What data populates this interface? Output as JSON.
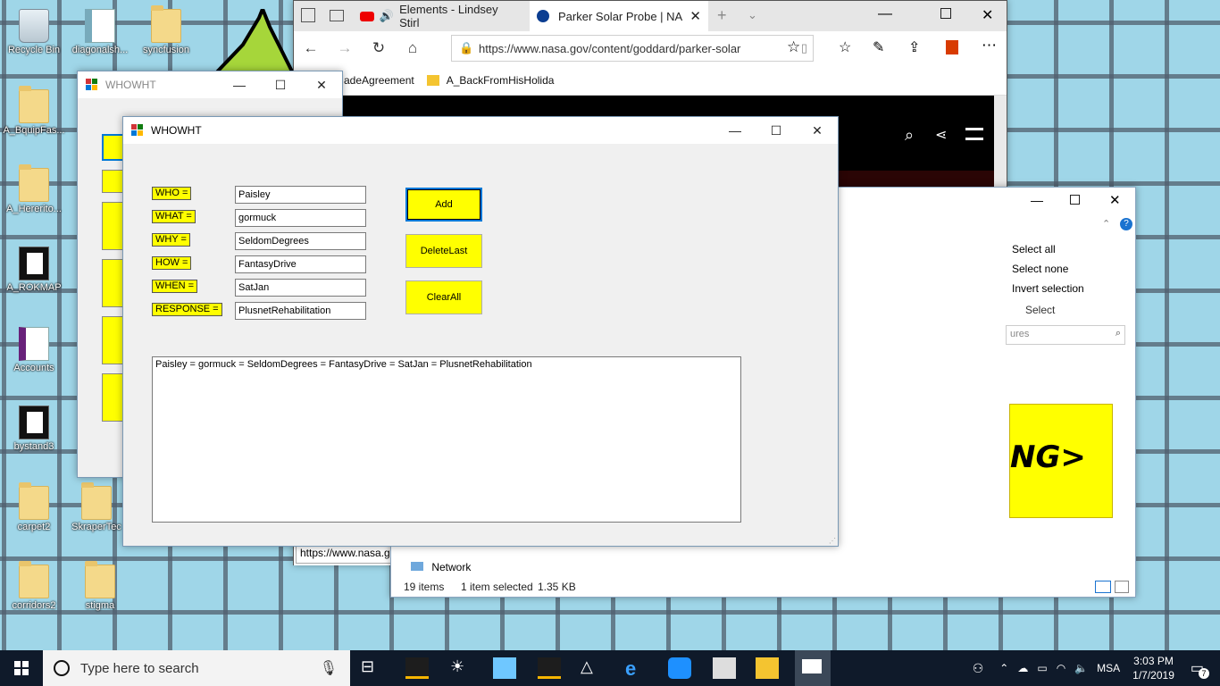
{
  "desktop": {
    "icons": [
      {
        "label": "Recycle Bin"
      },
      {
        "label": "diagonalsh..."
      },
      {
        "label": "syncfusion"
      },
      {
        "label": "A_BquipFas..."
      },
      {
        "label": "A_Hererito..."
      },
      {
        "label": "A_ROKMAP"
      },
      {
        "label": "Accounts"
      },
      {
        "label": "bystand3"
      },
      {
        "label": "carpet2"
      },
      {
        "label": "SkraperTec"
      },
      {
        "label": "corridors2"
      },
      {
        "label": "stigma"
      }
    ]
  },
  "browser": {
    "tab1_title": "Elements - Lindsey Stirl",
    "tab2_title": "Parker Solar Probe | NA",
    "url": "https://www.nasa.gov/content/goddard/parker-solar",
    "fav1": "adeAgreement",
    "fav2": "A_BackFromHisHolida",
    "status_url": "https://www.nasa.gov/",
    "banner_partial": "NG>"
  },
  "explorer": {
    "select_all": "Select all",
    "select_none": "Select none",
    "invert_selection": "Invert selection",
    "select_group": "Select",
    "search_placeholder": "ures",
    "nav_network": "Network",
    "status_items": "19 items",
    "status_selected": "1 item selected",
    "status_size": "1.35 KB"
  },
  "whowht_back": {
    "title": "WHOWHT"
  },
  "whowht": {
    "title": "WHOWHT",
    "labels": {
      "who": "WHO =",
      "what": "WHAT =",
      "why": "WHY =",
      "how": "HOW =",
      "when": "WHEN =",
      "response": "RESPONSE ="
    },
    "values": {
      "who": "Paisley",
      "what": "gormuck",
      "why": "SeldomDegrees",
      "how": "FantasyDrive",
      "when": "SatJan",
      "response": "PlusnetRehabilitation"
    },
    "buttons": {
      "add": "Add",
      "delete_last": "DeleteLast",
      "clear_all": "ClearAll"
    },
    "output": "Paisley = gormuck = SeldomDegrees = FantasyDrive = SatJan = PlusnetRehabilitation"
  },
  "taskbar": {
    "search_placeholder": "Type here to search",
    "language": "MSA",
    "time": "3:03 PM",
    "date": "1/7/2019",
    "notification_count": "7"
  }
}
